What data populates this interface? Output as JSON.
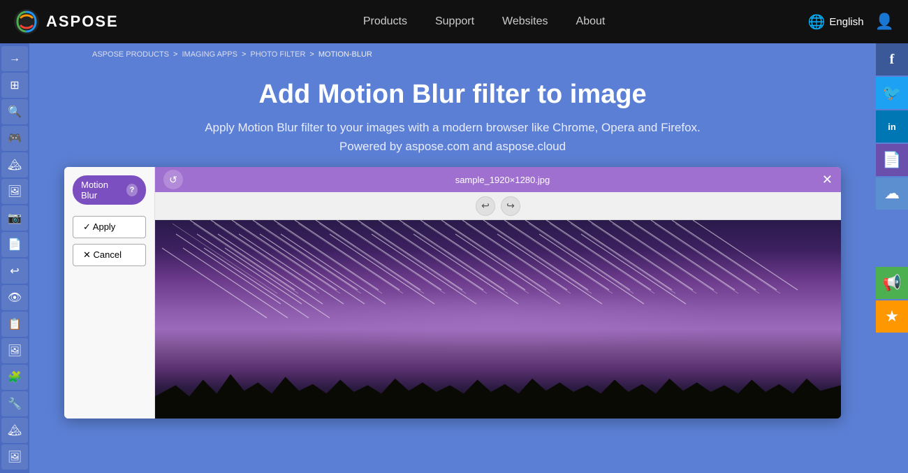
{
  "nav": {
    "logo_text": "ASPOSE",
    "links": [
      "Products",
      "Support",
      "Websites",
      "About"
    ],
    "language": "English",
    "lang_icon": "🌐"
  },
  "breadcrumb": {
    "items": [
      "ASPOSE PRODUCTS",
      "IMAGING APPS",
      "PHOTO FILTER",
      "MOTION-BLUR"
    ],
    "separators": [
      ">",
      ">",
      ">"
    ]
  },
  "hero": {
    "title": "Add Motion Blur filter to image",
    "subtitle": "Apply Motion Blur filter to your images with a modern browser like Chrome, Opera and Firefox.",
    "powered_by": "Powered by aspose.com and aspose.cloud"
  },
  "editor": {
    "filter_label": "Motion Blur",
    "help_label": "?",
    "apply_label": "✓ Apply",
    "cancel_label": "✕ Cancel",
    "filename": "sample_1920×1280.jpg",
    "toolbar_refresh": "↺",
    "toolbar_undo": "↩",
    "toolbar_redo": "↪",
    "toolbar_close": "✕"
  },
  "sidebar": {
    "buttons": [
      "→",
      "⊞",
      "🔍",
      "🎮",
      "🏔",
      "🖼",
      "📷",
      "📄",
      "↩",
      "👁",
      "📋",
      "🖼",
      "🧩",
      "🔧",
      "🏔",
      "🖼"
    ]
  },
  "social": {
    "buttons": [
      {
        "icon": "f",
        "class": "social-fb",
        "label": "facebook"
      },
      {
        "icon": "🐦",
        "class": "social-tw",
        "label": "twitter"
      },
      {
        "icon": "in",
        "class": "social-li",
        "label": "linkedin"
      },
      {
        "icon": "📄",
        "class": "social-file",
        "label": "file-share"
      },
      {
        "icon": "☁",
        "class": "social-cloud",
        "label": "cloud"
      }
    ],
    "action_buttons": [
      {
        "icon": "📢",
        "class": "social-megaphone",
        "label": "megaphone"
      },
      {
        "icon": "★",
        "class": "social-star",
        "label": "star"
      }
    ]
  }
}
